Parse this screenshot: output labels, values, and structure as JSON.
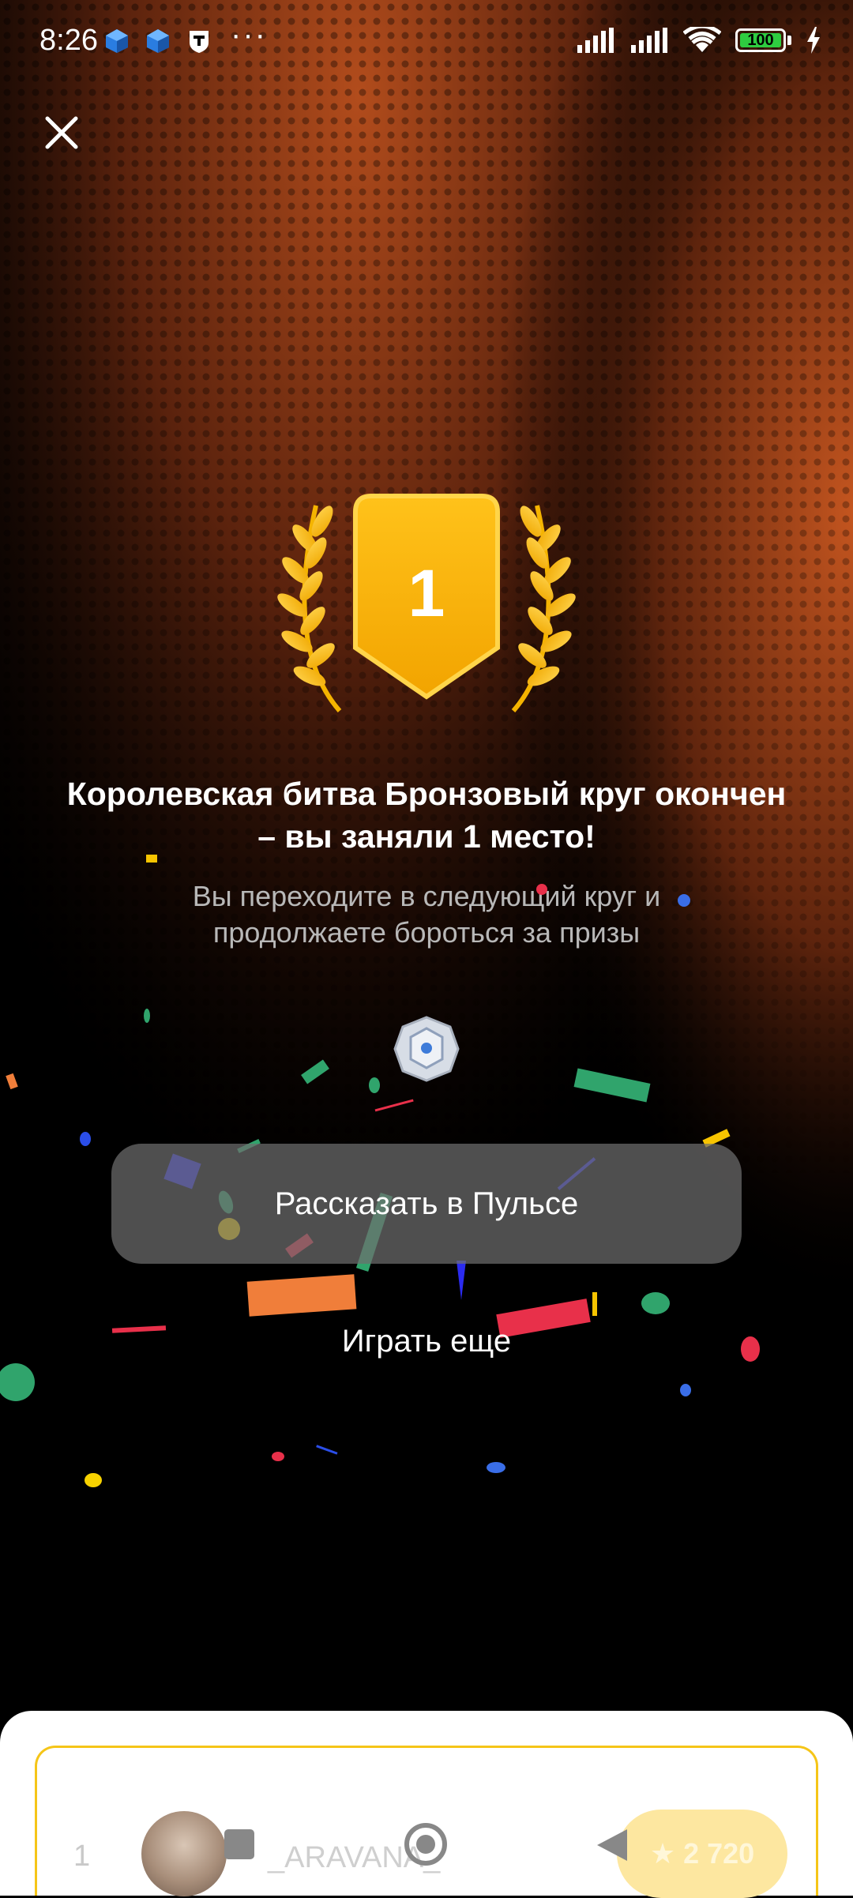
{
  "status_bar": {
    "time": "8:26",
    "app_icons": [
      "cube-app-icon",
      "cube-app-icon",
      "shield-t-app-icon"
    ],
    "more": "···",
    "battery_level": "100",
    "signal_bars": 4,
    "wifi": true,
    "charging": true
  },
  "result": {
    "place": "1",
    "title": "Королевская битва Бронзовый круг окончен – вы заняли 1 место!",
    "subtitle": "Вы переходите в следующий круг и продолжаете бороться за призы"
  },
  "actions": {
    "share_label": "Рассказать в Пульсе",
    "play_again_label": "Играть еще"
  },
  "leaderboard": {
    "rank": "1",
    "username": "_ARAVANA_",
    "score": "2 720"
  },
  "colors": {
    "accent_gold": "#F7B500",
    "background_glow": "#B8501E",
    "card_border": "#F5C518"
  }
}
